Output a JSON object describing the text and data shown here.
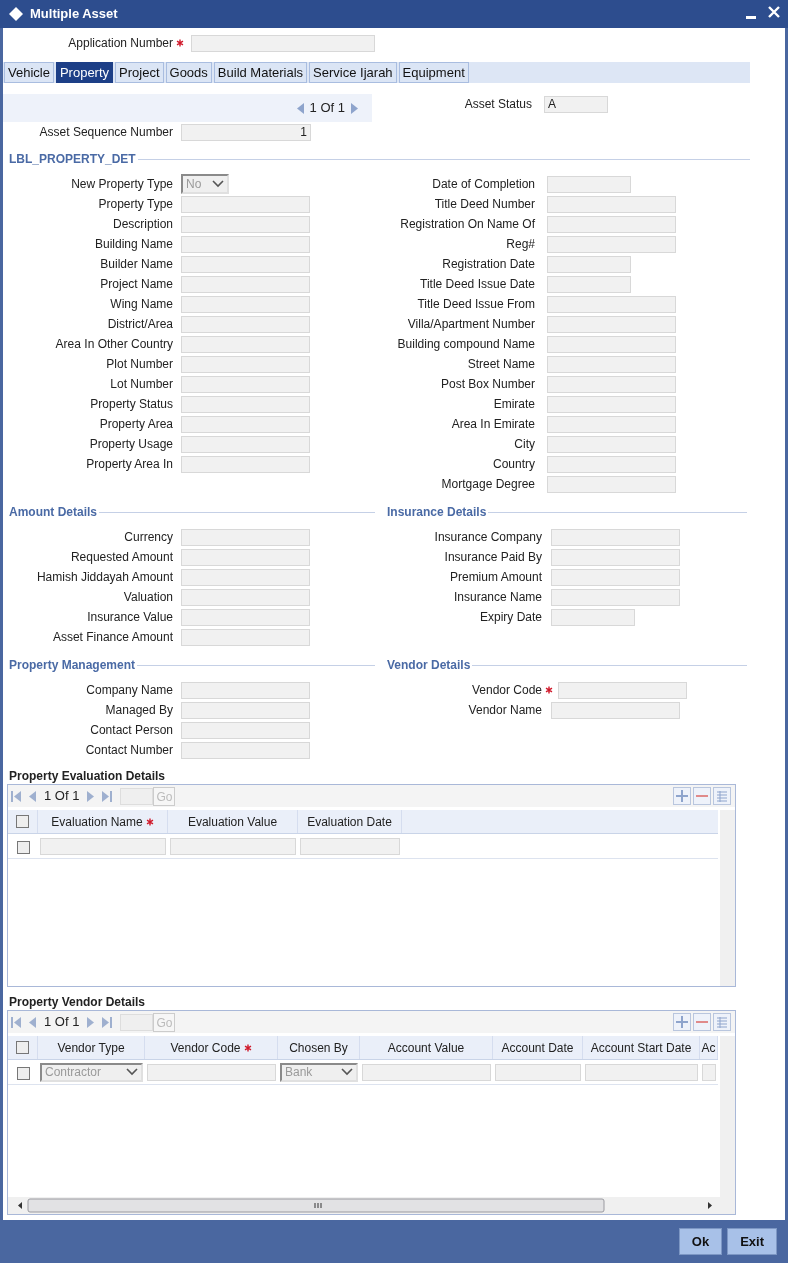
{
  "window": {
    "title": "Multiple Asset"
  },
  "application_number": {
    "label": "Application Number",
    "required": true
  },
  "tabs": [
    {
      "label": "Vehicle",
      "selected": false
    },
    {
      "label": "Property",
      "selected": true
    },
    {
      "label": "Project",
      "selected": false
    },
    {
      "label": "Goods",
      "selected": false
    },
    {
      "label": "Build Materials",
      "selected": false
    },
    {
      "label": "Service Ijarah",
      "selected": false
    },
    {
      "label": "Equipment",
      "selected": false
    }
  ],
  "pager": {
    "text": "1 Of 1"
  },
  "asset_status": {
    "label": "Asset Status",
    "value": "A"
  },
  "asset_sequence_number": {
    "label": "Asset Sequence Number",
    "value": "1"
  },
  "property_details": {
    "heading": "LBL_PROPERTY_DET",
    "left_fields": [
      {
        "label": "New Property Type",
        "kind": "select",
        "value": "No"
      },
      {
        "label": "Property Type",
        "kind": "text"
      },
      {
        "label": "Description",
        "kind": "text"
      },
      {
        "label": "Building Name",
        "kind": "text"
      },
      {
        "label": "Builder Name",
        "kind": "text"
      },
      {
        "label": "Project Name",
        "kind": "text"
      },
      {
        "label": "Wing Name",
        "kind": "text"
      },
      {
        "label": "District/Area",
        "kind": "text"
      },
      {
        "label": "Area In Other Country",
        "kind": "text"
      },
      {
        "label": "Plot Number",
        "kind": "text"
      },
      {
        "label": "Lot Number",
        "kind": "text"
      },
      {
        "label": "Property Status",
        "kind": "text"
      },
      {
        "label": "Property Area",
        "kind": "text"
      },
      {
        "label": "Property Usage",
        "kind": "text"
      },
      {
        "label": "Property Area In",
        "kind": "text"
      }
    ],
    "right_fields": [
      {
        "label": "Date of Completion",
        "kind": "date"
      },
      {
        "label": "Title Deed Number",
        "kind": "text"
      },
      {
        "label": "Registration On Name Of",
        "kind": "text"
      },
      {
        "label": "Reg#",
        "kind": "text"
      },
      {
        "label": "Registration Date",
        "kind": "date"
      },
      {
        "label": "Title Deed Issue Date",
        "kind": "date"
      },
      {
        "label": "Title Deed Issue From",
        "kind": "text"
      },
      {
        "label": "Villa/Apartment Number",
        "kind": "text"
      },
      {
        "label": "Building compound Name",
        "kind": "text"
      },
      {
        "label": "Street Name",
        "kind": "text"
      },
      {
        "label": "Post Box Number",
        "kind": "text"
      },
      {
        "label": "Emirate",
        "kind": "text"
      },
      {
        "label": "Area In Emirate",
        "kind": "text"
      },
      {
        "label": "City",
        "kind": "text"
      },
      {
        "label": "Country",
        "kind": "text"
      },
      {
        "label": "Mortgage Degree",
        "kind": "text"
      }
    ]
  },
  "amount_details": {
    "heading": "Amount Details",
    "fields": [
      {
        "label": "Currency",
        "kind": "text"
      },
      {
        "label": "Requested Amount",
        "kind": "text"
      },
      {
        "label": "Hamish Jiddayah Amount",
        "kind": "text"
      },
      {
        "label": "Valuation",
        "kind": "text"
      },
      {
        "label": "Insurance Value",
        "kind": "text"
      },
      {
        "label": "Asset Finance Amount",
        "kind": "text"
      }
    ]
  },
  "insurance_details": {
    "heading": "Insurance Details",
    "fields": [
      {
        "label": "Insurance Company",
        "kind": "text"
      },
      {
        "label": "Insurance Paid By",
        "kind": "text"
      },
      {
        "label": "Premium Amount",
        "kind": "text"
      },
      {
        "label": "Insurance Name",
        "kind": "text"
      },
      {
        "label": "Expiry Date",
        "kind": "date"
      }
    ]
  },
  "property_management": {
    "heading": "Property Management",
    "fields": [
      {
        "label": "Company Name",
        "kind": "text"
      },
      {
        "label": "Managed By",
        "kind": "text"
      },
      {
        "label": "Contact Person",
        "kind": "text"
      },
      {
        "label": "Contact Number",
        "kind": "text"
      }
    ]
  },
  "vendor_details": {
    "heading": "Vendor Details",
    "fields": [
      {
        "label": "Vendor Code",
        "kind": "text",
        "required": true
      },
      {
        "label": "Vendor Name",
        "kind": "text",
        "required": false
      }
    ]
  },
  "evaluation_grid": {
    "title": "Property Evaluation Details",
    "pager": "1 Of 1",
    "go": "Go",
    "header_checked": false,
    "row_checked": false,
    "columns": [
      {
        "label": "Evaluation Name",
        "required": true
      },
      {
        "label": "Evaluation Value",
        "required": false
      },
      {
        "label": "Evaluation Date",
        "required": false
      }
    ],
    "row": [
      {
        "kind": "text"
      },
      {
        "kind": "text"
      },
      {
        "kind": "text"
      }
    ]
  },
  "vendor_grid": {
    "title": "Property Vendor Details",
    "pager": "1 Of 1",
    "go": "Go",
    "header_checked": false,
    "row_checked": false,
    "columns": [
      {
        "label": "Vendor Type",
        "required": false
      },
      {
        "label": "Vendor Code",
        "required": true
      },
      {
        "label": "Chosen By",
        "required": false
      },
      {
        "label": "Account Value",
        "required": false
      },
      {
        "label": "Account Date",
        "required": false
      },
      {
        "label": "Account Start Date",
        "required": false
      },
      {
        "label": "Ac",
        "required": false
      }
    ],
    "row": [
      {
        "kind": "select",
        "value": "Contractor"
      },
      {
        "kind": "text"
      },
      {
        "kind": "select",
        "value": "Bank"
      },
      {
        "kind": "text"
      },
      {
        "kind": "text"
      },
      {
        "kind": "text"
      },
      {
        "kind": "text"
      }
    ]
  },
  "buttons": [
    "Ok",
    "Exit"
  ]
}
